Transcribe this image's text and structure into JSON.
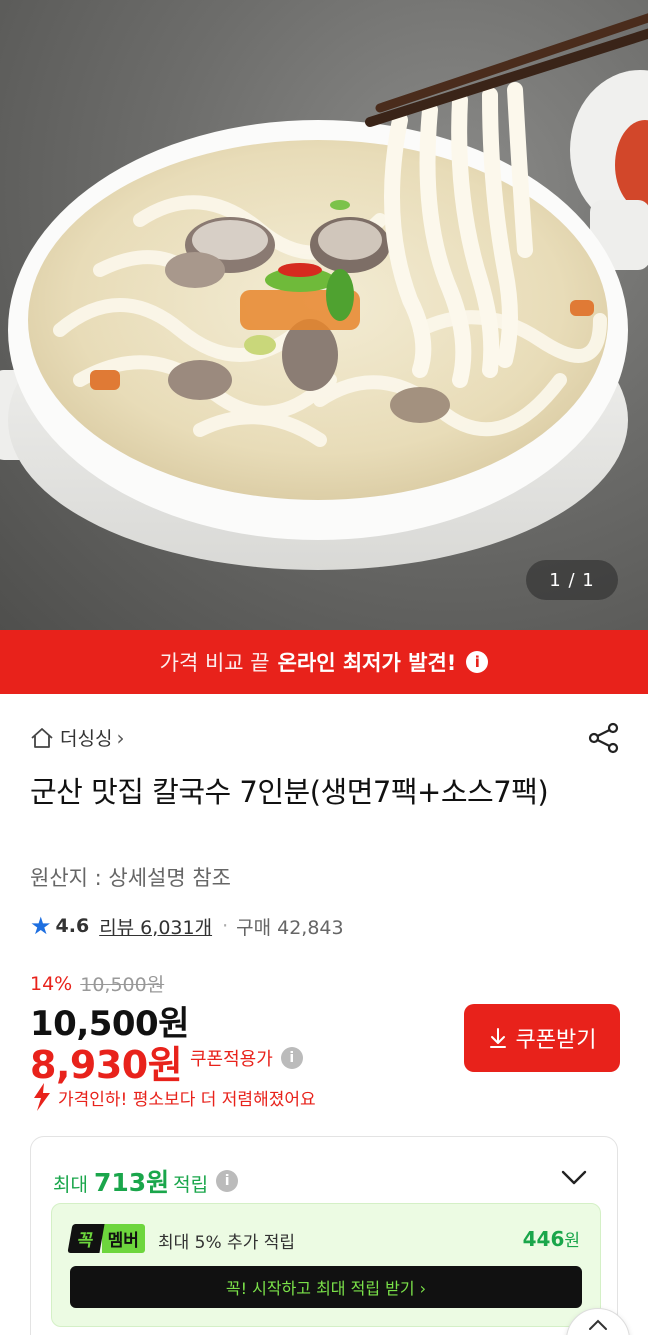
{
  "hero": {
    "image_description": "",
    "counter": "1 / 1"
  },
  "banner": {
    "prefix": "가격 비교 끝",
    "highlight": "온라인 최저가 발견!",
    "info_icon": "info-icon"
  },
  "store": {
    "icon": "home-icon",
    "name": "더싱싱",
    "chevron": "›"
  },
  "product": {
    "title": "군산 맛집 칼국수 7인분(생면7팩+소스7팩)",
    "origin": "원산지 : 상세설명 참조"
  },
  "rating": {
    "star_icon": "star-icon",
    "score": "4.6",
    "review": "리뷰 6,031개",
    "dot": "·",
    "purchases": "구매 42,843"
  },
  "pricing": {
    "discount_rate": "14%",
    "original_price": "10,500원",
    "sale_price": "10,500원",
    "coupon_price": "8,930원",
    "coupon_price_label": "쿠폰적용가",
    "price_drop_message": "가격인하! 평소보다 더 저렴해졌어요"
  },
  "coupon_button": {
    "icon": "download-icon",
    "label": "쿠폰받기"
  },
  "rewards": {
    "prefix": "최대",
    "amount": "713원",
    "suffix": "적립",
    "toggle_icon": "chevron-down-icon",
    "member_badge_left": "꼭",
    "member_badge_right": "멤버",
    "member_desc": "최대 5% 추가 적립",
    "member_amount_num": "446",
    "member_amount_unit": "원",
    "cta": "꼭! 시작하고 최대 적립 받기 ›"
  },
  "colors": {
    "accent_red": "#e8221b",
    "rating_blue": "#1e6fe0",
    "reward_green": "#1aa64b",
    "member_green": "#6dd63d"
  }
}
